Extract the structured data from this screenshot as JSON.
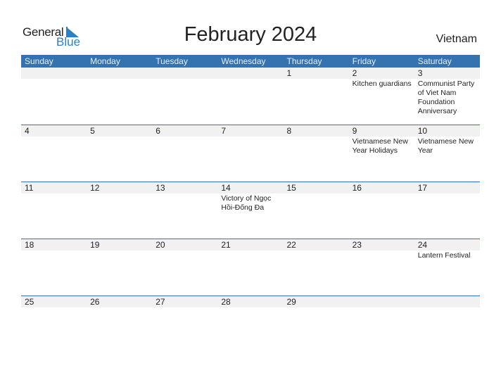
{
  "logo": {
    "general": "General",
    "blue": "Blue"
  },
  "title": "February 2024",
  "country": "Vietnam",
  "accent_color": "#3572b0",
  "weekdays": [
    "Sunday",
    "Monday",
    "Tuesday",
    "Wednesday",
    "Thursday",
    "Friday",
    "Saturday"
  ],
  "weeks": [
    {
      "days": [
        "",
        "",
        "",
        "",
        "1",
        "2",
        "3"
      ],
      "events": [
        "",
        "",
        "",
        "",
        "",
        "Kitchen guardians",
        "Communist Party of Viet Nam Foundation Anniversary"
      ]
    },
    {
      "days": [
        "4",
        "5",
        "6",
        "7",
        "8",
        "9",
        "10"
      ],
      "events": [
        "",
        "",
        "",
        "",
        "",
        "Vietnamese New Year Holidays",
        "Vietnamese New Year"
      ]
    },
    {
      "days": [
        "11",
        "12",
        "13",
        "14",
        "15",
        "16",
        "17"
      ],
      "events": [
        "",
        "",
        "",
        "Victory of Ngọc Hồi-Đống Đa",
        "",
        "",
        ""
      ]
    },
    {
      "days": [
        "18",
        "19",
        "20",
        "21",
        "22",
        "23",
        "24"
      ],
      "events": [
        "",
        "",
        "",
        "",
        "",
        "",
        "Lantern Festival"
      ]
    },
    {
      "days": [
        "25",
        "26",
        "27",
        "28",
        "29",
        "",
        ""
      ],
      "events": [
        "",
        "",
        "",
        "",
        "",
        "",
        ""
      ]
    }
  ]
}
